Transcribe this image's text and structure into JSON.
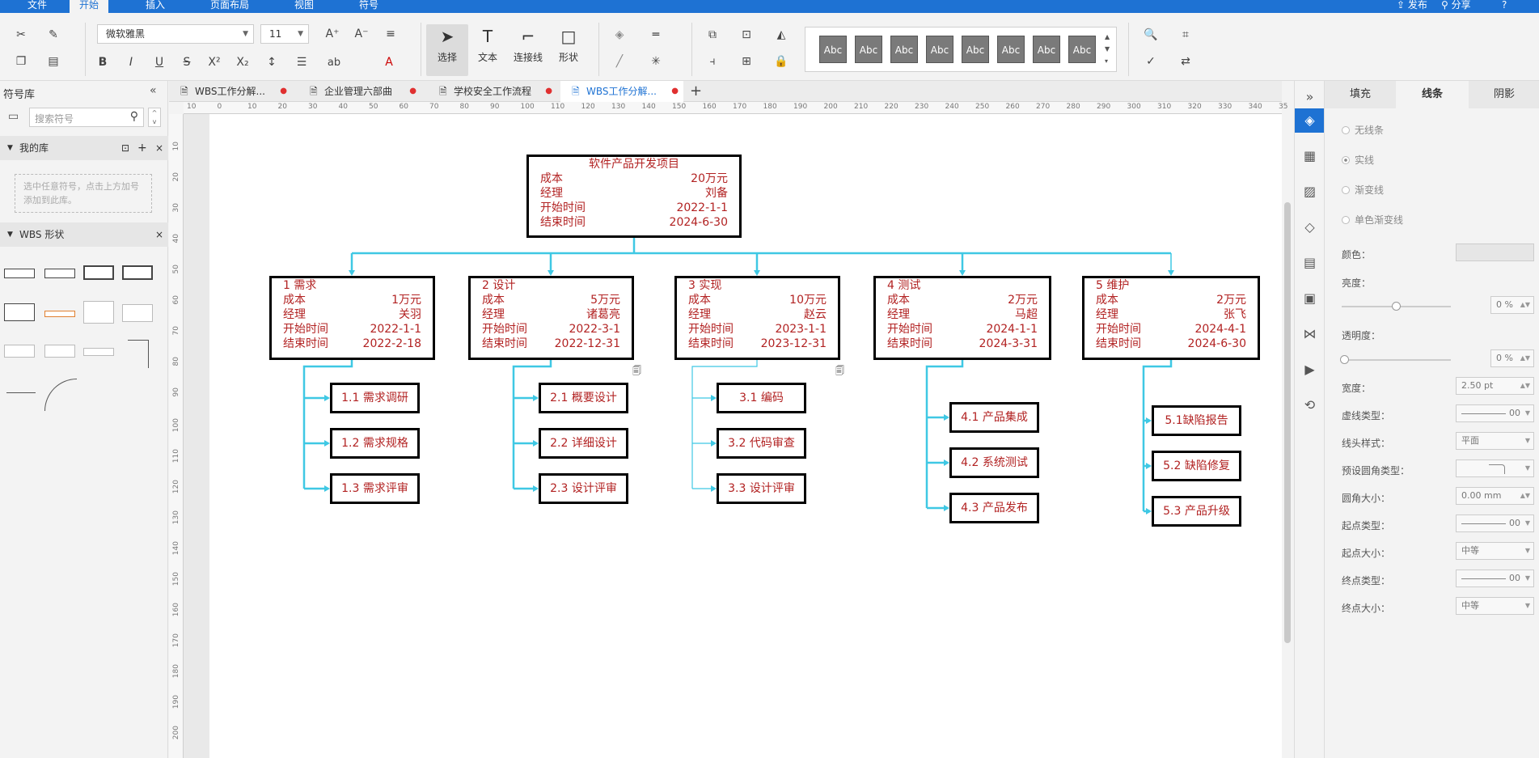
{
  "menubar": {
    "items": [
      "文件",
      "开始",
      "插入",
      "页面布局",
      "视图",
      "符号"
    ],
    "active": "开始",
    "right": [
      "发布",
      "分享",
      "?"
    ]
  },
  "ribbon": {
    "font_name": "微软雅黑",
    "font_size": "11",
    "big_buttons": [
      "选择",
      "文本",
      "连接线",
      "形状"
    ],
    "style_swatches": [
      "Abc",
      "Abc",
      "Abc",
      "Abc",
      "Abc",
      "Abc",
      "Abc",
      "Abc"
    ]
  },
  "left_panel": {
    "title": "符号库",
    "search_placeholder": "搜索符号",
    "my_library": "我的库",
    "my_library_hint": "选中任意符号，点击上方加号添加到此库。",
    "wbs_section": "WBS 形状"
  },
  "tabs": [
    {
      "label": "WBS工作分解..."
    },
    {
      "label": "企业管理六部曲"
    },
    {
      "label": "学校安全工作流程"
    },
    {
      "label": "WBS工作分解...",
      "active": true
    }
  ],
  "ruler": {
    "h_ticks": [
      "10",
      "0",
      "10",
      "20",
      "30",
      "40",
      "50",
      "60",
      "70",
      "80",
      "90",
      "100",
      "110",
      "120",
      "130",
      "140",
      "150",
      "160",
      "170",
      "180",
      "190",
      "200",
      "210",
      "220",
      "230",
      "240",
      "250",
      "260",
      "270",
      "280",
      "290",
      "300",
      "310",
      "320",
      "330",
      "340",
      "35"
    ],
    "v_ticks": [
      "10",
      "20",
      "30",
      "40",
      "50",
      "60",
      "70",
      "80",
      "90",
      "100",
      "110",
      "120",
      "130",
      "140",
      "150",
      "160",
      "170",
      "180",
      "190",
      "200"
    ]
  },
  "diagram": {
    "root": {
      "title": "软件产品开发项目",
      "rows": [
        [
          "成本",
          "20万元"
        ],
        [
          "经理",
          "刘备"
        ],
        [
          "开始时间",
          "2022-1-1"
        ],
        [
          "结束时间",
          "2024-6-30"
        ]
      ]
    },
    "phases": [
      {
        "title": "1 需求",
        "rows": [
          [
            "成本",
            "1万元"
          ],
          [
            "经理",
            "关羽"
          ],
          [
            "开始时间",
            "2022-1-1"
          ],
          [
            "结束时间",
            "2022-2-18"
          ]
        ],
        "tasks": [
          "1.1 需求调研",
          "1.2 需求规格",
          "1.3 需求评审"
        ]
      },
      {
        "title": "2 设计",
        "rows": [
          [
            "成本",
            "5万元"
          ],
          [
            "经理",
            "诸葛亮"
          ],
          [
            "开始时间",
            "2022-3-1"
          ],
          [
            "结束时间",
            "2022-12-31"
          ]
        ],
        "tasks": [
          "2.1 概要设计",
          "2.2 详细设计",
          "2.3 设计评审"
        ]
      },
      {
        "title": "3 实现",
        "rows": [
          [
            "成本",
            "10万元"
          ],
          [
            "经理",
            "赵云"
          ],
          [
            "开始时间",
            "2023-1-1"
          ],
          [
            "结束时间",
            "2023-12-31"
          ]
        ],
        "tasks": [
          "3.1 编码",
          "3.2 代码审查",
          "3.3 设计评审"
        ]
      },
      {
        "title": "4 测试",
        "rows": [
          [
            "成本",
            "2万元"
          ],
          [
            "经理",
            "马超"
          ],
          [
            "开始时间",
            "2024-1-1"
          ],
          [
            "结束时间",
            "2024-3-31"
          ]
        ],
        "tasks": [
          "4.1 产品集成",
          "4.2 系统测试",
          "4.3 产品发布"
        ]
      },
      {
        "title": "5 维护",
        "rows": [
          [
            "成本",
            "2万元"
          ],
          [
            "经理",
            "张飞"
          ],
          [
            "开始时间",
            "2024-4-1"
          ],
          [
            "结束时间",
            "2024-6-30"
          ]
        ],
        "tasks": [
          "5.1缺陷报告",
          "5.2 缺陷修复",
          "5.3 产品升级"
        ]
      }
    ],
    "colors": {
      "text": "#b22222",
      "connector": "#3fc8e4",
      "border": "#000000"
    }
  },
  "right_panel": {
    "tabs": [
      "填充",
      "线条",
      "阴影"
    ],
    "active_tab": "线条",
    "line_options": [
      "无线条",
      "实线",
      "渐变线",
      "单色渐变线"
    ],
    "selected_option": "实线",
    "labels": {
      "color": "颜色：",
      "brightness": "亮度：",
      "transparency": "透明度：",
      "width": "宽度：",
      "dash": "虚线类型：",
      "cap": "线头样式：",
      "corner_type": "预设圆角类型：",
      "corner_size": "圆角大小：",
      "start_type": "起点类型：",
      "start_size": "起点大小：",
      "end_type": "终点类型：",
      "end_size": "终点大小："
    },
    "values": {
      "brightness": "0 %",
      "transparency": "0 %",
      "width": "2.50 pt",
      "dash": "00",
      "cap": "平面",
      "corner_size": "0.00 mm",
      "start_type": "00",
      "start_size": "中等",
      "end_type": "00",
      "end_size": "中等"
    }
  }
}
